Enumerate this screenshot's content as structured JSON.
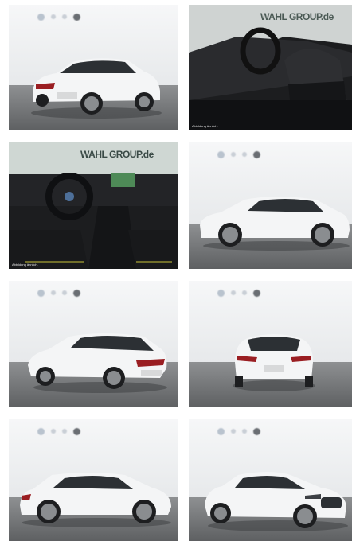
{
  "gallery": {
    "tiles": [
      {
        "view": "rear-three-quarter",
        "kind": "studio"
      },
      {
        "view": "interior-seats",
        "kind": "interior",
        "brand": "WAHL GROUP.de",
        "caption": "Abbildung ähnlich."
      },
      {
        "view": "interior-dashboard",
        "kind": "interior",
        "brand": "WAHL GROUP.de",
        "caption": "Abbildung ähnlich."
      },
      {
        "view": "side-left",
        "kind": "studio"
      },
      {
        "view": "rear-three-quarter-left",
        "kind": "studio"
      },
      {
        "view": "rear",
        "kind": "studio"
      },
      {
        "view": "side-right",
        "kind": "studio"
      },
      {
        "view": "front-three-quarter",
        "kind": "studio"
      }
    ]
  },
  "colors": {
    "car_body": "#f4f5f6",
    "floor": "#6a6c6e",
    "wall": "#eef0f1",
    "interior": "#1c1d1f",
    "accent_stitch": "#c9c23a"
  }
}
